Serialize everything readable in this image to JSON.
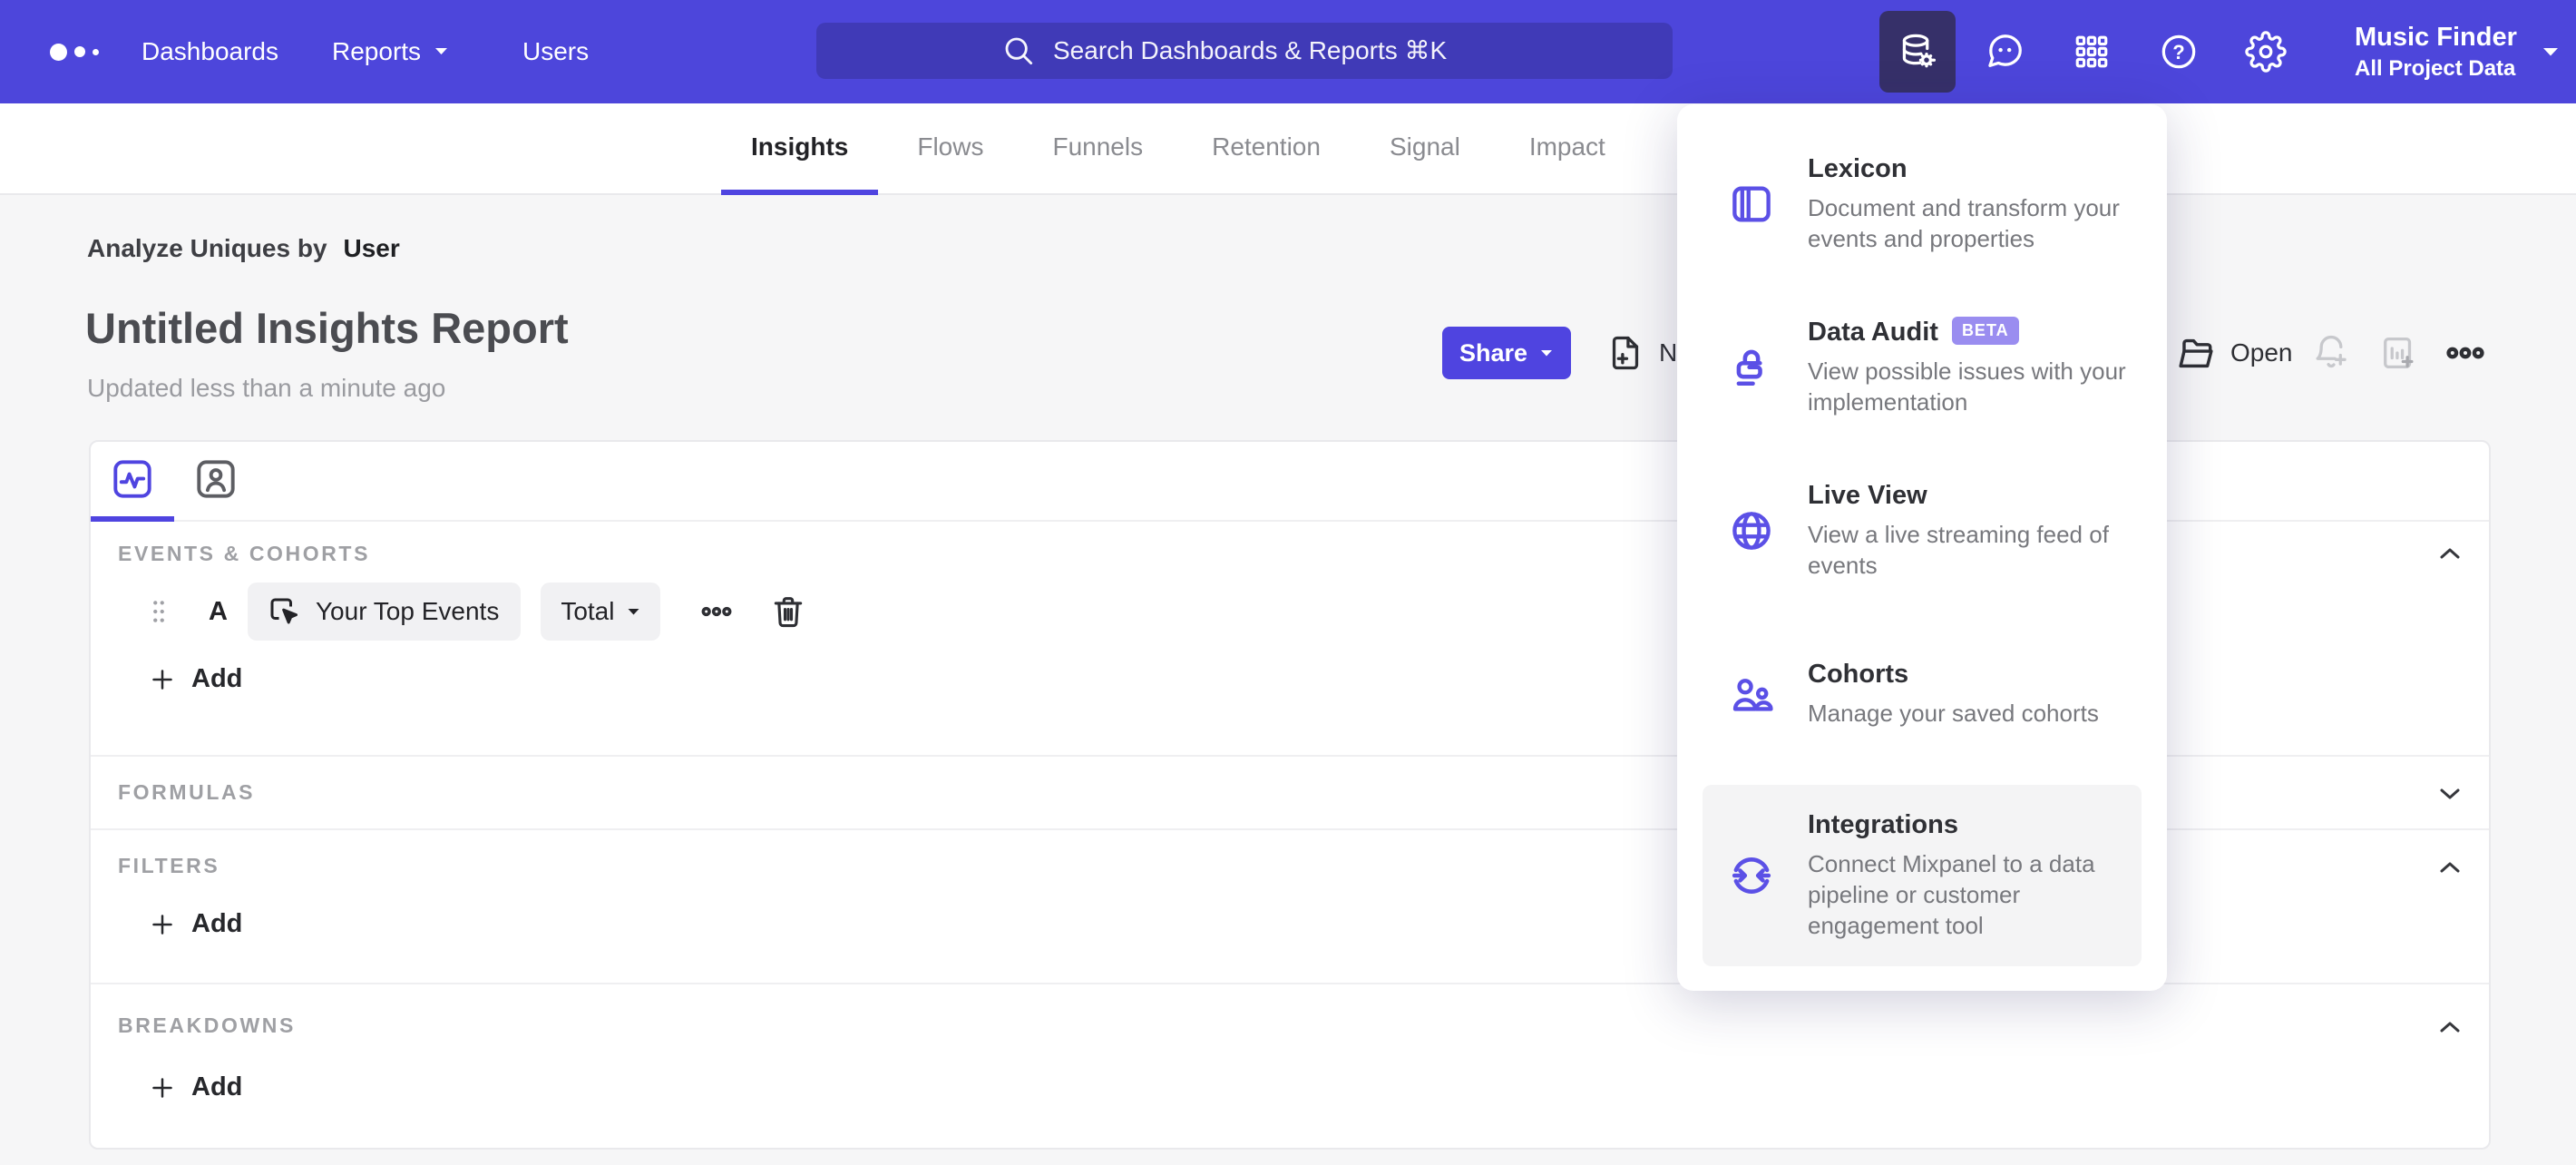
{
  "topbar": {
    "nav": [
      {
        "label": "Dashboards"
      },
      {
        "label": "Reports"
      },
      {
        "label": "Users"
      }
    ],
    "search_placeholder": "Search Dashboards & Reports ⌘K",
    "project": {
      "name": "Music Finder",
      "scope": "All Project Data"
    }
  },
  "tabs": [
    {
      "label": "Insights"
    },
    {
      "label": "Flows"
    },
    {
      "label": "Funnels"
    },
    {
      "label": "Retention"
    },
    {
      "label": "Signal"
    },
    {
      "label": "Impact"
    }
  ],
  "report": {
    "analyze_prefix": "Analyze Uniques by",
    "analyze_entity": "User",
    "title": "Untitled Insights Report",
    "updated": "Updated less than a minute ago"
  },
  "actions": {
    "share": "Share",
    "new": "New",
    "open": "Open"
  },
  "builder": {
    "sections": [
      {
        "header": "EVENTS & COHORTS"
      },
      {
        "header": "FORMULAS"
      },
      {
        "header": "FILTERS"
      },
      {
        "header": "BREAKDOWNS"
      }
    ],
    "event_row": {
      "label": "A",
      "event": "Your Top Events",
      "aggregation": "Total"
    },
    "add_label": "Add"
  },
  "data_menu": {
    "items": [
      {
        "title": "Lexicon",
        "description": "Document and transform your events and properties"
      },
      {
        "title": "Data Audit",
        "badge": "BETA",
        "description": "View possible issues with your implementation"
      },
      {
        "title": "Live View",
        "description": "View a live streaming feed of events"
      },
      {
        "title": "Cohorts",
        "description": "Manage your saved cohorts"
      },
      {
        "title": "Integrations",
        "description": "Connect Mixpanel to a data pipeline or customer engagement tool"
      }
    ]
  },
  "colors": {
    "topbar": "#4d46db",
    "accent": "#4f44e0",
    "icon": "#5b50e6",
    "beta_badge": "#9a8df0"
  }
}
